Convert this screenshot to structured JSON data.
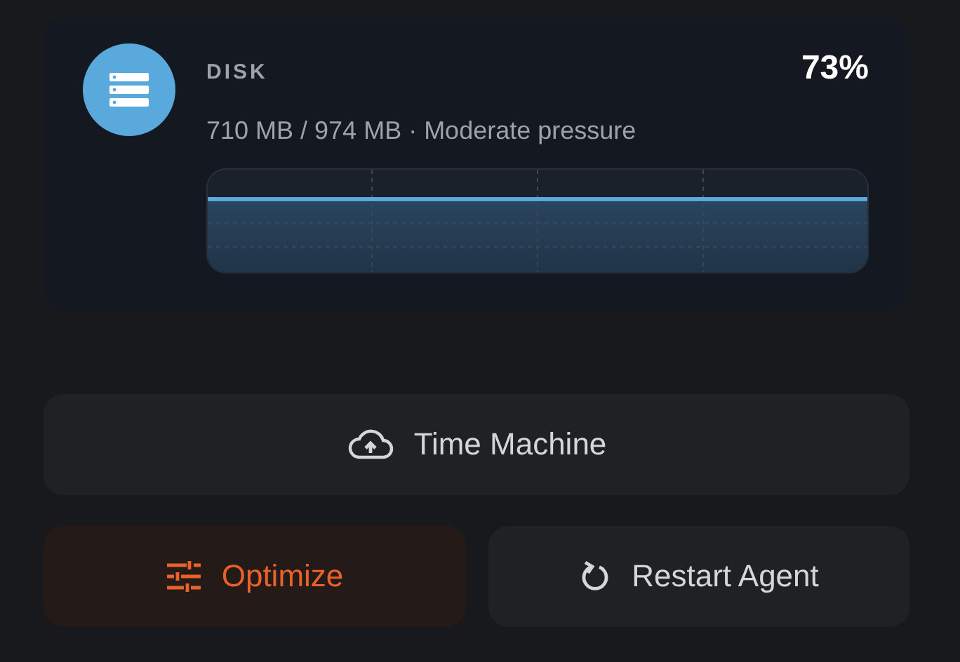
{
  "disk_card": {
    "label": "DISK",
    "percent": "73%",
    "usage": "710 MB / 974 MB · Moderate pressure"
  },
  "buttons": [
    {
      "label": "Time Machine",
      "highlighted": false
    },
    {
      "label": "Optimize",
      "highlighted": true
    },
    {
      "label": "Restart Agent",
      "highlighted": false
    }
  ]
}
